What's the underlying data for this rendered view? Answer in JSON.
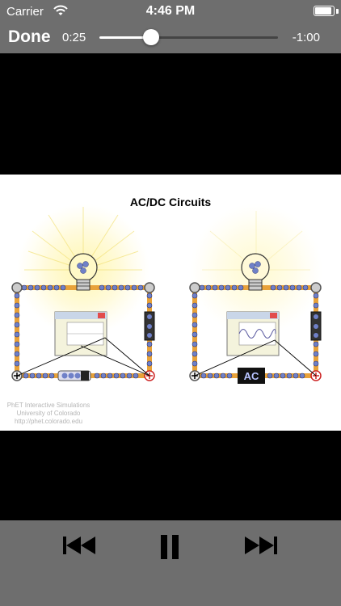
{
  "status_bar": {
    "carrier": "Carrier",
    "time": "4:46 PM",
    "battery_level": 0.9
  },
  "player": {
    "done_label": "Done",
    "elapsed": "0:25",
    "remaining": "-1:00",
    "progress": 0.29
  },
  "video": {
    "title": "AC/DC Circuits",
    "panel_left_switch": "",
    "panel_right_switch": "AC",
    "credit_lines": [
      "PhET Interactive Simulations",
      "University of Colorado",
      "http://phet.colorado.edu"
    ]
  },
  "controls": {
    "rewind": "rewind-icon",
    "pause": "pause-icon",
    "forward": "fast-forward-icon"
  },
  "colors": {
    "chrome": "#6e6e6e",
    "wire": "#e8a23a",
    "bead": "#6f80c8"
  }
}
